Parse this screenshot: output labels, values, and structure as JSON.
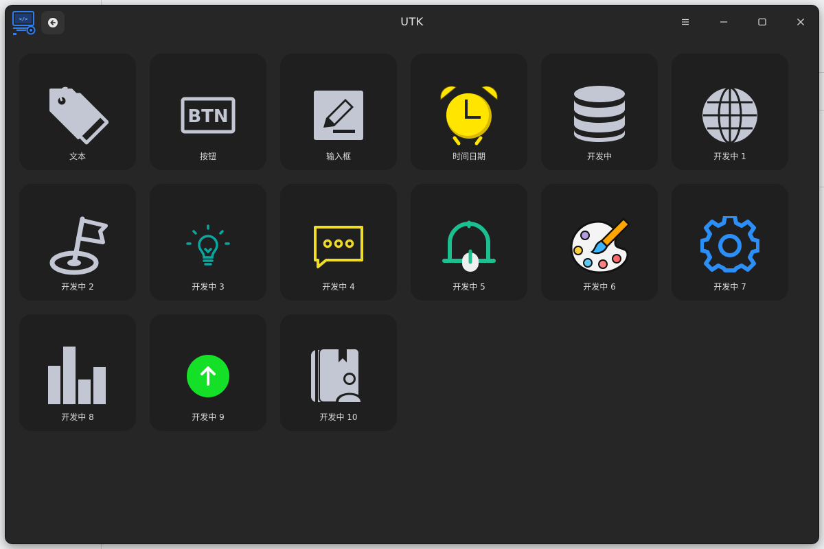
{
  "window": {
    "title": "UTK"
  },
  "titlebar": {
    "icons": [
      "app-logo-icon",
      "back-arrow-icon",
      "menu-icon",
      "minimize-icon",
      "maximize-icon",
      "close-icon"
    ]
  },
  "tiles": [
    {
      "label": "文本",
      "icon": "tag-icon"
    },
    {
      "label": "按钮",
      "icon": "btn-icon"
    },
    {
      "label": "输入框",
      "icon": "edit-icon"
    },
    {
      "label": "时间日期",
      "icon": "alarm-clock-icon"
    },
    {
      "label": "开发中",
      "icon": "database-icon"
    },
    {
      "label": "开发中 1",
      "icon": "globe-icon"
    },
    {
      "label": "开发中 2",
      "icon": "flag-icon"
    },
    {
      "label": "开发中 3",
      "icon": "lightbulb-icon"
    },
    {
      "label": "开发中 4",
      "icon": "chat-icon"
    },
    {
      "label": "开发中 5",
      "icon": "bell-icon"
    },
    {
      "label": "开发中 6",
      "icon": "palette-icon"
    },
    {
      "label": "开发中 7",
      "icon": "gear-icon"
    },
    {
      "label": "开发中 8",
      "icon": "bar-chart-icon"
    },
    {
      "label": "开发中 9",
      "icon": "upload-icon"
    },
    {
      "label": "开发中 10",
      "icon": "contact-book-icon"
    }
  ],
  "icon_text": {
    "btn": "BTN"
  },
  "colors": {
    "window_bg": "#262626",
    "tile_bg": "#1f1f1f",
    "icon_gray": "#c3c7d4",
    "clock_yellow": "#ffe500",
    "bulb_teal": "#0aa6a0",
    "chat_yellow": "#f0dc2a",
    "bell_green": "#1cbf8f",
    "gear_blue": "#2b8ff7",
    "upload_green": "#14e028"
  }
}
